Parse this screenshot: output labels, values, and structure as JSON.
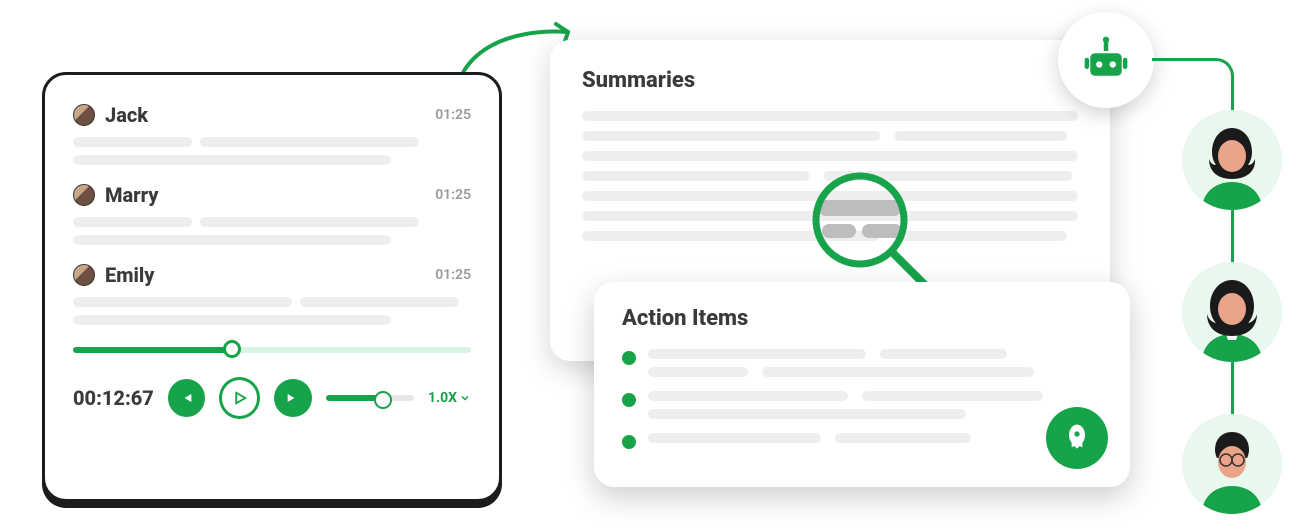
{
  "colors": {
    "accent": "#16a34a",
    "text": "#3a3a3a",
    "skeleton": "#eeeeee"
  },
  "transcript": {
    "speakers": [
      {
        "name": "Jack",
        "time": "01:25"
      },
      {
        "name": "Marry",
        "time": "01:25"
      },
      {
        "name": "Emily",
        "time": "01:25"
      }
    ],
    "elapsed": "00:12:67",
    "speed_label": "1.0X",
    "progress_pct": 40,
    "volume_pct": 65,
    "buttons": {
      "prev": "previous",
      "play": "play",
      "next": "next"
    }
  },
  "summaries": {
    "title": "Summaries",
    "icon": "magnifier"
  },
  "action_items": {
    "title": "Action Items",
    "count": 3,
    "launch_icon": "rocket"
  },
  "assistant": {
    "icon": "robot"
  },
  "people": [
    {
      "label": "person-1"
    },
    {
      "label": "person-2"
    },
    {
      "label": "person-3"
    }
  ]
}
